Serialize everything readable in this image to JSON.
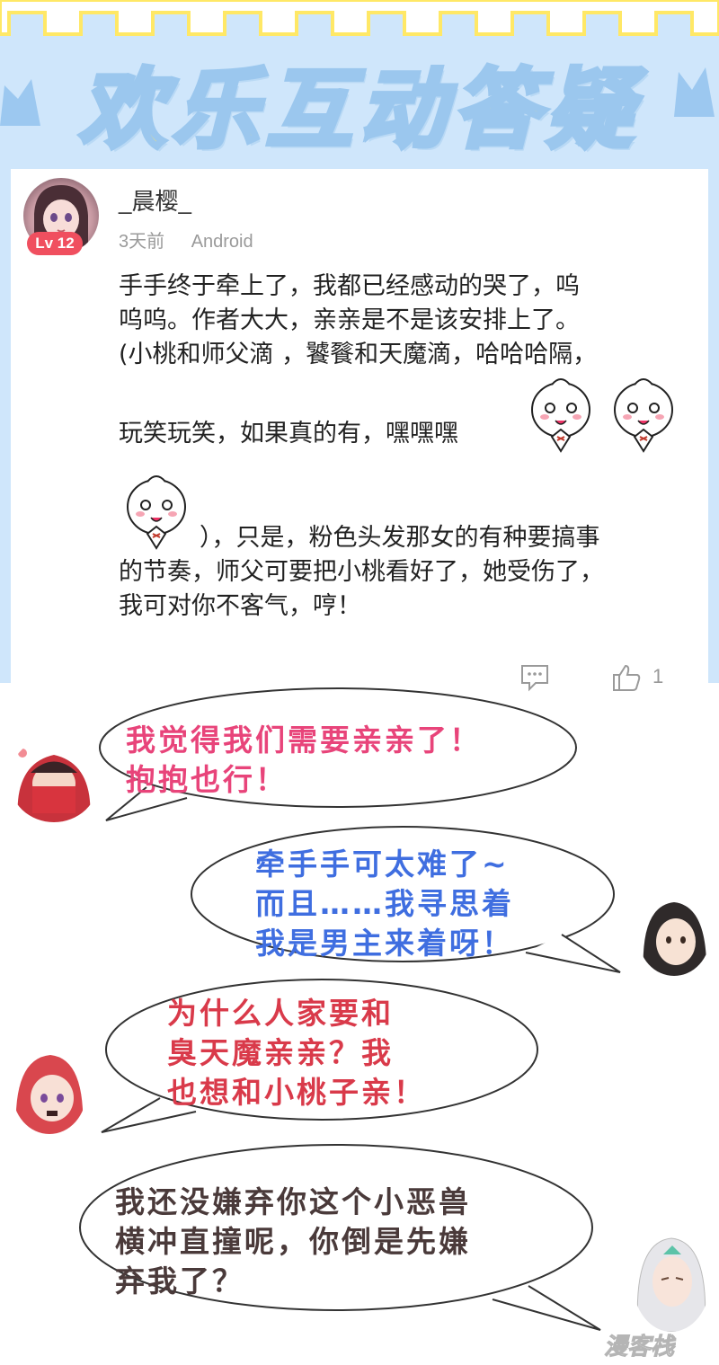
{
  "banner": {
    "title": "欢乐互动答疑"
  },
  "comment": {
    "username": "_晨樱_",
    "level": "Lv 12",
    "time": "3天前",
    "platform": "Android",
    "lines": [
      "手手终于牵上了，我都已经感动的哭了，呜",
      "呜呜。作者大大，亲亲是不是该安排上了。",
      "(小桃和师父滴 ，饕餮和天魔滴，哈哈哈隔，",
      "玩笑玩笑，如果真的有，嘿嘿嘿",
      "），只是，粉色头发那女的有种要搞事",
      "的节奏，师父可要把小桃看好了，她受伤了，",
      "我可对你不客气，哼！"
    ],
    "like_count": "1",
    "emoji_name": "smug-bun-emoji"
  },
  "dialog": [
    {
      "lines": [
        "我觉得我们需要亲亲了！",
        "抱抱也行！"
      ],
      "color": "#e8447a"
    },
    {
      "lines": [
        "牵手手可太难了~",
        "而且……我寻思着",
        "我是男主来着呀！"
      ],
      "color": "#3f6ee0"
    },
    {
      "lines": [
        "为什么人家要和",
        "臭天魔亲亲？我",
        "也想和小桃子亲！"
      ],
      "color": "#d93a4a"
    },
    {
      "lines": [
        "我还没嫌弃你这个小恶兽",
        "横冲直撞呢，你倒是先嫌",
        "弃我了？"
      ],
      "color": "#4a3a3a"
    }
  ],
  "watermark": "漫客栈",
  "colors": {
    "banner_bg": "#cfe6fb",
    "title_fill": "#ffe866",
    "badge": "#f04f5f"
  }
}
